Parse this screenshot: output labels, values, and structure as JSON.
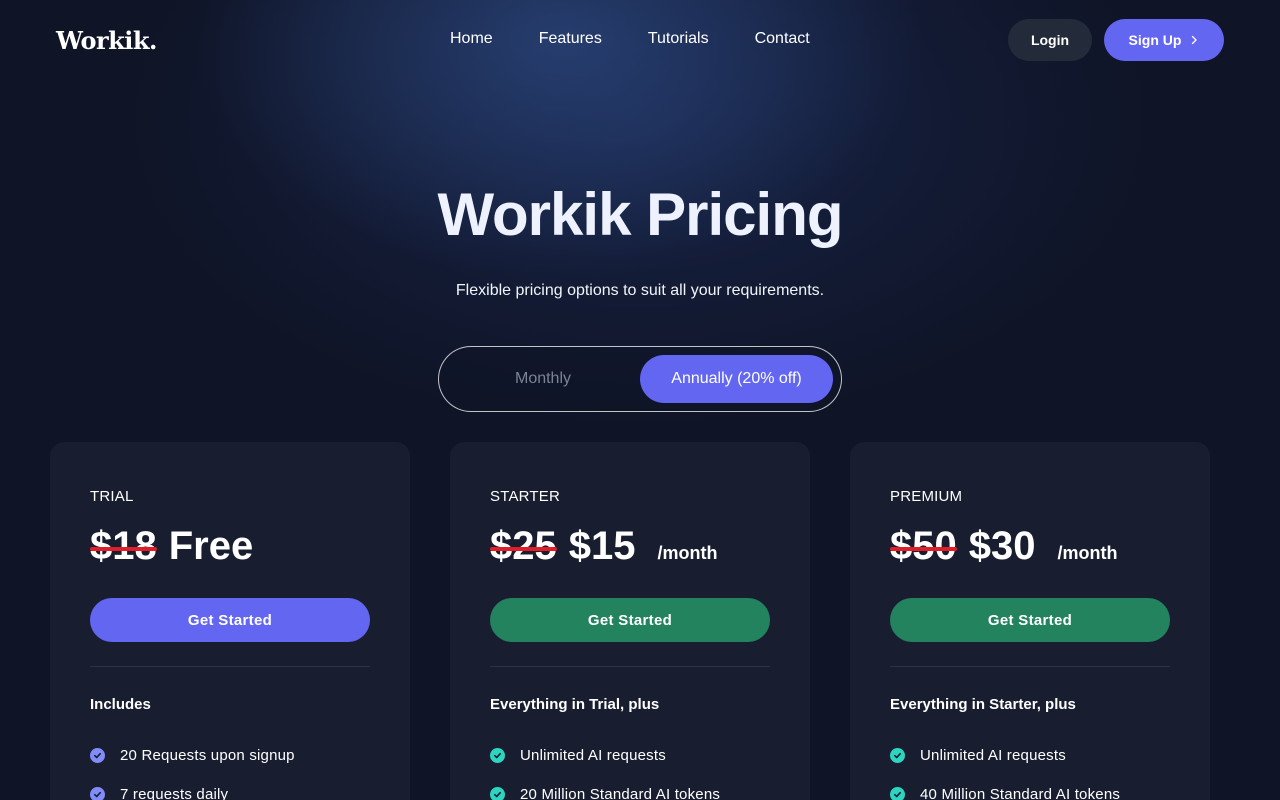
{
  "nav": {
    "logo": "Workik.",
    "links": [
      "Home",
      "Features",
      "Tutorials",
      "Contact"
    ],
    "login": "Login",
    "signup": "Sign Up"
  },
  "hero": {
    "title": "Workik Pricing",
    "subtitle": "Flexible pricing options to suit all your requirements."
  },
  "billing_toggle": {
    "monthly": "Monthly",
    "annually": "Annually (20% off)",
    "selected": "annually"
  },
  "plans": [
    {
      "tier": "TRIAL",
      "old_price": "$18",
      "new_price": "Free",
      "per": "",
      "cta": "Get Started",
      "includes_heading": "Includes",
      "features": [
        "20 Requests upon signup",
        "7 requests daily"
      ]
    },
    {
      "tier": "STARTER",
      "old_price": "$25",
      "new_price": "$15",
      "per": "/month",
      "cta": "Get Started",
      "includes_heading": "Everything in Trial, plus",
      "features": [
        "Unlimited AI requests",
        "20 Million Standard AI tokens"
      ]
    },
    {
      "tier": "PREMIUM",
      "old_price": "$50",
      "new_price": "$30",
      "per": "/month",
      "cta": "Get Started",
      "includes_heading": "Everything in Starter, plus",
      "features": [
        "Unlimited AI requests",
        "40 Million Standard AI tokens"
      ]
    }
  ],
  "colors": {
    "background": "#0f1426",
    "accent": "#6366f1",
    "cta_green": "#22835e",
    "strike": "#e11d27",
    "card": "#181d30"
  },
  "icons": {
    "signup": "chevron-right-icon",
    "feature": "check-circle-icon"
  }
}
